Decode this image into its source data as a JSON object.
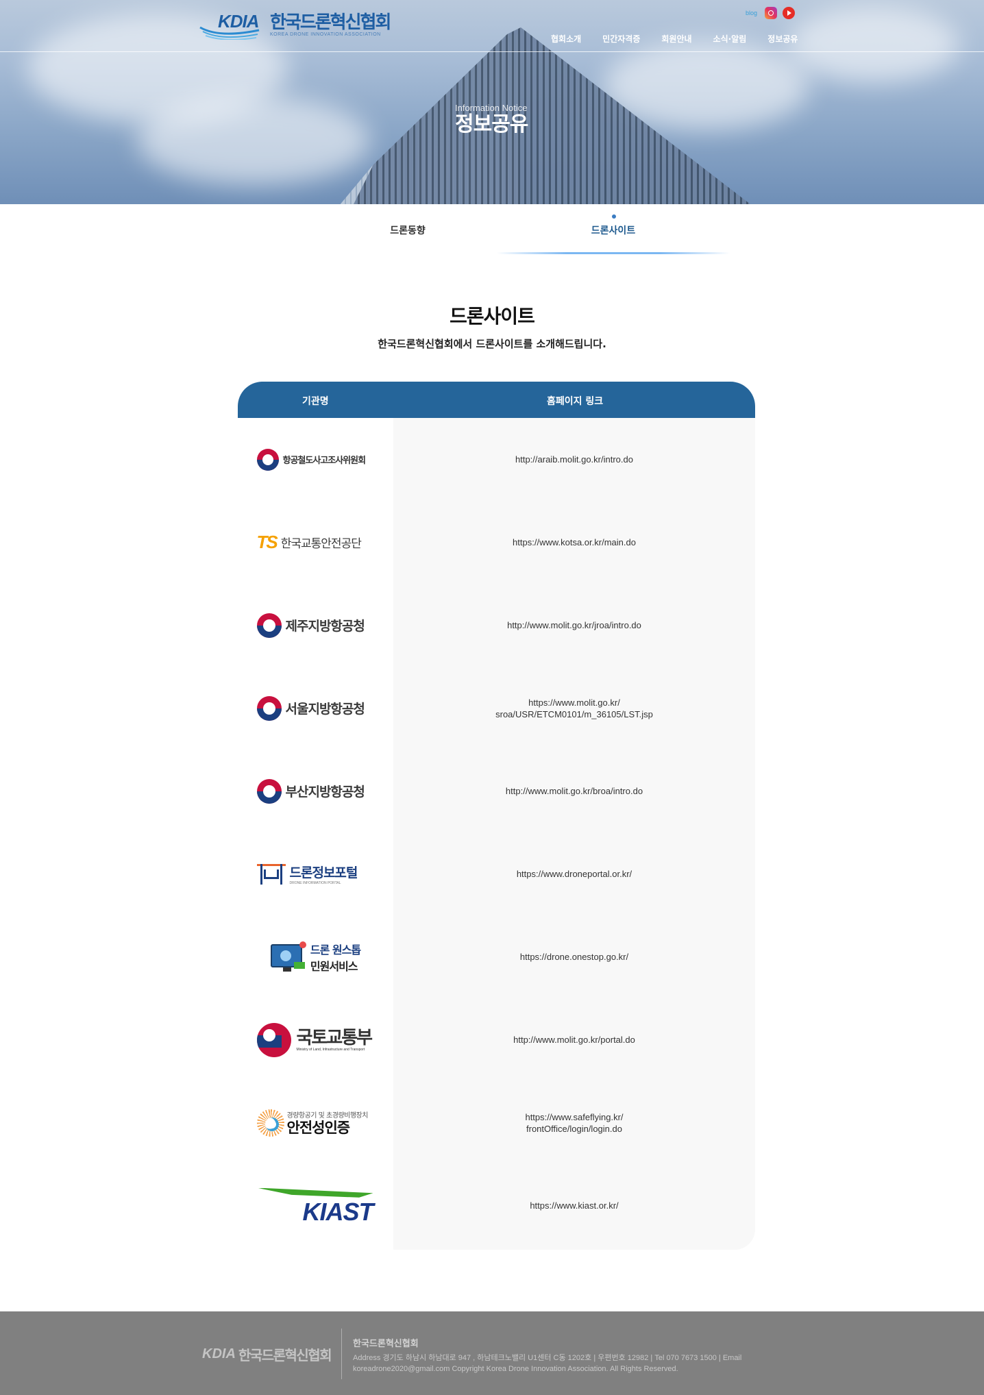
{
  "header": {
    "logo_latin": "KDIA",
    "logo_korean": "한국드론혁신협회",
    "logo_english": "KOREA DRONE INNOVATION ASSOCIATION",
    "social": {
      "blog": "blog",
      "instagram": "instagram-icon",
      "youtube": "youtube-icon"
    },
    "nav": [
      "협회소개",
      "민간자격증",
      "회원안내",
      "소식·알림",
      "정보공유"
    ]
  },
  "hero": {
    "subtitle": "Information Notice",
    "title": "정보공유"
  },
  "tabs": [
    {
      "label": "드론동향",
      "active": false
    },
    {
      "label": "드론사이트",
      "active": true
    }
  ],
  "main": {
    "title": "드론사이트",
    "description": "한국드론혁신협회에서 드론사이트를 소개해드립니다."
  },
  "table": {
    "headers": {
      "org": "기관명",
      "link": "홈페이지 링크"
    },
    "rows": [
      {
        "org": "항공철도사고조사위원회",
        "logo": "taeguk-icon",
        "link": [
          "http://araib.molit.go.kr/intro.do"
        ]
      },
      {
        "org": "한국교통안전공단",
        "logo_mark": "TS",
        "link": [
          "https://www.kotsa.or.kr/main.do"
        ]
      },
      {
        "org": "제주지방항공청",
        "logo": "taeguk-icon",
        "link": [
          "http://www.molit.go.kr/jroa/intro.do"
        ]
      },
      {
        "org": "서울지방항공청",
        "logo": "taeguk-icon",
        "link": [
          "https://www.molit.go.kr/",
          "sroa/USR/ETCM0101/m_36105/LST.jsp"
        ]
      },
      {
        "org": "부산지방항공청",
        "logo": "taeguk-icon",
        "link": [
          "http://www.molit.go.kr/broa/intro.do"
        ]
      },
      {
        "org": "드론정보포털",
        "org_en": "DRONE INFORMATION PORTAL",
        "link": [
          "https://www.droneportal.or.kr/"
        ]
      },
      {
        "org": "드론 원스톱",
        "org_line2": "민원서비스",
        "link": [
          "https://drone.onestop.go.kr/"
        ]
      },
      {
        "org": "국토교통부",
        "org_en": "Ministry of Land, Infrastructure and Transport",
        "link": [
          "http://www.molit.go.kr/portal.do"
        ]
      },
      {
        "org": "안전성인증",
        "org_sub": "경량항공기 및 초경량비행장치",
        "link": [
          "https://www.safeflying.kr/",
          "frontOffice/login/login.do"
        ]
      },
      {
        "org": "KIAST",
        "link": [
          "https://www.kiast.or.kr/"
        ]
      }
    ]
  },
  "footer": {
    "logo_latin": "KDIA",
    "logo_korean": "한국드론혁신협회",
    "name": "한국드론혁신협회",
    "address_line": "Address  경기도 하남시 하남대로 947 , 하남테크노밸리 U1센터 C동 1202호   |   우편번호  12982   |   Tel  070 7673 1500   |   Email",
    "email": "koreadrone2020@gmail.com",
    "copyright": "Copyright Korea Drone Innovation Association. All Rights Reserved."
  }
}
